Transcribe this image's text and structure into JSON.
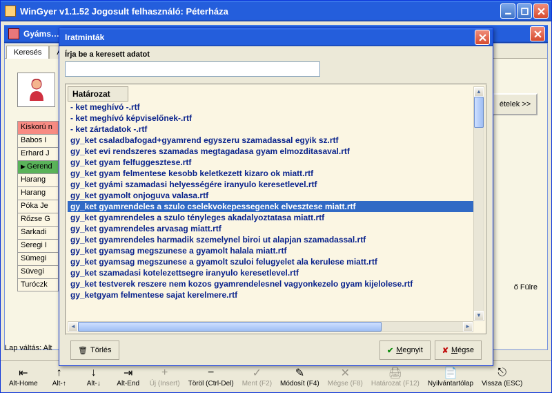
{
  "main_window": {
    "title": "WinGyer v1.1.52 Jogosult felhasználó: Péterháza"
  },
  "mdi_window": {
    "title": "Gyáms…"
  },
  "tabs": {
    "search": "Keresés",
    "other": "Ala"
  },
  "right_button": "ételek >>",
  "footer_lap": "Lap váltás: Alt",
  "footer_fulre": "ő Fülre",
  "names": [
    {
      "text": "Kiskorú n",
      "red": true
    },
    {
      "text": "Babos I"
    },
    {
      "text": "Erhard J"
    },
    {
      "text": "Gerend",
      "sel": true
    },
    {
      "text": "Harang"
    },
    {
      "text": "Harang"
    },
    {
      "text": "Póka Je"
    },
    {
      "text": "Rőzse G"
    },
    {
      "text": "Sarkadi"
    },
    {
      "text": "Seregi I"
    },
    {
      "text": "Sümegi"
    },
    {
      "text": "Süvegi"
    },
    {
      "text": "Turóczk"
    }
  ],
  "toolbar": [
    {
      "label": "Alt-Home",
      "icon": "⇤"
    },
    {
      "label": "Alt-↑",
      "icon": "↑"
    },
    {
      "label": "Alt-↓",
      "icon": "↓"
    },
    {
      "label": "Alt-End",
      "icon": "⇥"
    },
    {
      "label": "Új (Insert)",
      "icon": "+",
      "disabled": true
    },
    {
      "label": "Töröl (Ctrl-Del)",
      "icon": "−"
    },
    {
      "label": "Ment (F2)",
      "icon": "✓",
      "disabled": true
    },
    {
      "label": "Módosít (F4)",
      "icon": "✎"
    },
    {
      "label": "Mégse (F8)",
      "icon": "✕",
      "disabled": true
    },
    {
      "label": "Határozat (F12)",
      "icon": "🖨",
      "disabled": true
    },
    {
      "label": "Nyilvántartólap",
      "icon": "📄"
    },
    {
      "label": "Vissza (ESC)",
      "icon": "⎋"
    }
  ],
  "modal": {
    "title": "Iratminták",
    "search_label": "Írja be a keresett adatot",
    "search_value": "",
    "list_header": "Határozat",
    "list_items": [
      "- ket meghívó -.rtf",
      "- ket meghívó képviselőnek-.rtf",
      "- ket zártadatok -.rtf",
      "gy_ket csaladbafogad+gyamrend egyszeru szamadassal egyik sz.rtf",
      "gy_ket evi rendszeres szamadas megtagadasa gyam elmozditasaval.rtf",
      "gy_ket gyam felfuggesztese.rtf",
      "gy_ket gyam felmentese kesobb keletkezett kizaro ok miatt.rtf",
      "gy_ket gyámi szamadasi helyességére iranyulo keresetlevel.rtf",
      "gy_ket gyamolt onjoguva valasa.rtf",
      "gy_ket gyamrendeles a szulo cselekvokepessegenek elvesztese miatt.rtf",
      "gy_ket gyamrendeles a szulo tényleges akadalyoztatasa miatt.rtf",
      "gy_ket gyamrendeles arvasag miatt.rtf",
      "gy_ket gyamrendeles harmadik szemelynel biroi ut alapjan szamadassal.rtf",
      "gy_ket gyamsag megszunese a gyamolt halala miatt.rtf",
      "gy_ket gyamsag megszunese a gyamolt szuloi felugyelet ala kerulese miatt.rtf",
      "gy_ket szamadasi kotelezettsegre iranyulo keresetlevel.rtf",
      "gy_ket testverek reszere nem kozos gyamrendelesnel vagyonkezelo gyam kijelolese.rtf",
      "gy_ketgyam felmentese sajat kerelmere.rtf"
    ],
    "selected_index": 9,
    "buttons": {
      "delete_label": "Törlés",
      "open_u": "M",
      "open_rest": "egnyit",
      "cancel_u": "M",
      "cancel_rest": "égse"
    }
  }
}
